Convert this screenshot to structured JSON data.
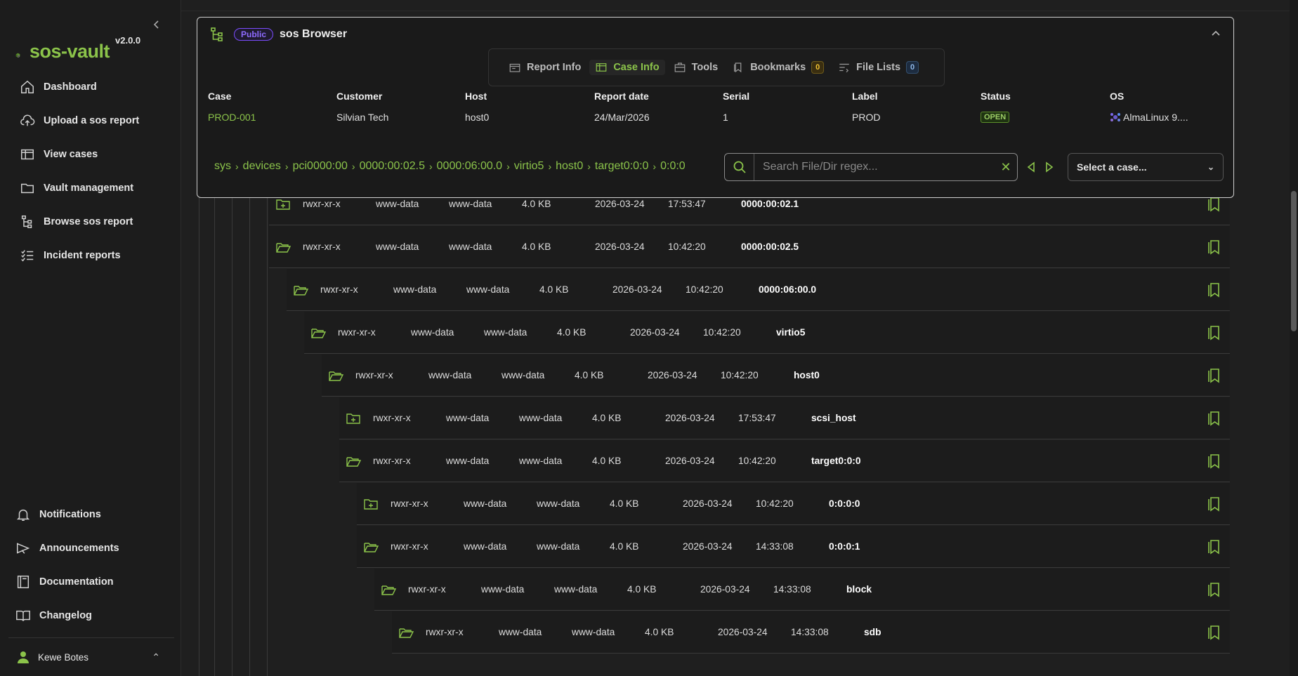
{
  "app": {
    "version": "v2.0.0",
    "logo_text": "sos-vault",
    "brand_color": "#8bc34a"
  },
  "sidebar": {
    "items": [
      {
        "label": "Dashboard",
        "icon": "home-icon"
      },
      {
        "label": "Upload a sos report",
        "icon": "cloud-upload-icon"
      },
      {
        "label": "View cases",
        "icon": "cases-icon"
      },
      {
        "label": "Vault management",
        "icon": "folder-icon"
      },
      {
        "label": "Browse sos report",
        "icon": "tree-icon"
      },
      {
        "label": "Incident reports",
        "icon": "checklist-icon"
      }
    ],
    "bottom_items": [
      {
        "label": "Notifications",
        "icon": "bell-icon"
      },
      {
        "label": "Announcements",
        "icon": "megaphone-icon"
      },
      {
        "label": "Documentation",
        "icon": "book-icon"
      },
      {
        "label": "Changelog",
        "icon": "open-book-icon"
      }
    ],
    "user": "Kewe Botes"
  },
  "panel": {
    "badge": "Public",
    "title": "sos Browser",
    "tabs": [
      {
        "label": "Report Info",
        "icon": "report-icon",
        "active": false
      },
      {
        "label": "Case Info",
        "icon": "case-icon",
        "active": true
      },
      {
        "label": "Tools",
        "icon": "toolbox-icon",
        "active": false
      },
      {
        "label": "Bookmarks",
        "icon": "bookmarks-icon",
        "active": false,
        "count": "0"
      },
      {
        "label": "File Lists",
        "icon": "filelist-icon",
        "active": false,
        "count": "0"
      }
    ],
    "case_info": {
      "headers": [
        "Case",
        "Customer",
        "Host",
        "Report date",
        "Serial",
        "Label",
        "Status",
        "OS"
      ],
      "values": {
        "case": "PROD-001",
        "customer": "Silvian Tech",
        "host": "host0",
        "report_date": "24/Mar/2026",
        "serial": "1",
        "label": "PROD",
        "status": "OPEN",
        "os": "AlmaLinux 9...."
      }
    },
    "breadcrumb": [
      "sys",
      "devices",
      "pci0000:00",
      "0000:00:02.5",
      "0000:06:00.0",
      "virtio5",
      "host0",
      "target0:0:0",
      "0:0:0"
    ],
    "search": {
      "placeholder": "Search File/Dir regex...",
      "value": ""
    },
    "select_case": {
      "placeholder": "Select a case..."
    }
  },
  "tree": {
    "rows": [
      {
        "perm": "rwxr-xr-x",
        "user": "www-data",
        "group": "www-data",
        "size": "4.0 KB",
        "date": "2026-03-24",
        "time": "17:53:47",
        "name": "0000:00:02.1",
        "type": "folder-plus",
        "depth": 0
      },
      {
        "perm": "rwxr-xr-x",
        "user": "www-data",
        "group": "www-data",
        "size": "4.0 KB",
        "date": "2026-03-24",
        "time": "10:42:20",
        "name": "0000:00:02.5",
        "type": "folder-open",
        "depth": 0
      },
      {
        "perm": "rwxr-xr-x",
        "user": "www-data",
        "group": "www-data",
        "size": "4.0 KB",
        "date": "2026-03-24",
        "time": "10:42:20",
        "name": "0000:06:00.0",
        "type": "folder-open",
        "depth": 1
      },
      {
        "perm": "rwxr-xr-x",
        "user": "www-data",
        "group": "www-data",
        "size": "4.0 KB",
        "date": "2026-03-24",
        "time": "10:42:20",
        "name": "virtio5",
        "type": "folder-open",
        "depth": 2
      },
      {
        "perm": "rwxr-xr-x",
        "user": "www-data",
        "group": "www-data",
        "size": "4.0 KB",
        "date": "2026-03-24",
        "time": "10:42:20",
        "name": "host0",
        "type": "folder-open",
        "depth": 3
      },
      {
        "perm": "rwxr-xr-x",
        "user": "www-data",
        "group": "www-data",
        "size": "4.0 KB",
        "date": "2026-03-24",
        "time": "17:53:47",
        "name": "scsi_host",
        "type": "folder-plus",
        "depth": 4
      },
      {
        "perm": "rwxr-xr-x",
        "user": "www-data",
        "group": "www-data",
        "size": "4.0 KB",
        "date": "2026-03-24",
        "time": "10:42:20",
        "name": "target0:0:0",
        "type": "folder-open",
        "depth": 4
      },
      {
        "perm": "rwxr-xr-x",
        "user": "www-data",
        "group": "www-data",
        "size": "4.0 KB",
        "date": "2026-03-24",
        "time": "10:42:20",
        "name": "0:0:0:0",
        "type": "folder-plus",
        "depth": 5
      },
      {
        "perm": "rwxr-xr-x",
        "user": "www-data",
        "group": "www-data",
        "size": "4.0 KB",
        "date": "2026-03-24",
        "time": "14:33:08",
        "name": "0:0:0:1",
        "type": "folder-open",
        "depth": 5
      },
      {
        "perm": "rwxr-xr-x",
        "user": "www-data",
        "group": "www-data",
        "size": "4.0 KB",
        "date": "2026-03-24",
        "time": "14:33:08",
        "name": "block",
        "type": "folder-open",
        "depth": 6
      },
      {
        "perm": "rwxr-xr-x",
        "user": "www-data",
        "group": "www-data",
        "size": "4.0 KB",
        "date": "2026-03-24",
        "time": "14:33:08",
        "name": "sdb",
        "type": "folder-open",
        "depth": 7
      }
    ]
  }
}
